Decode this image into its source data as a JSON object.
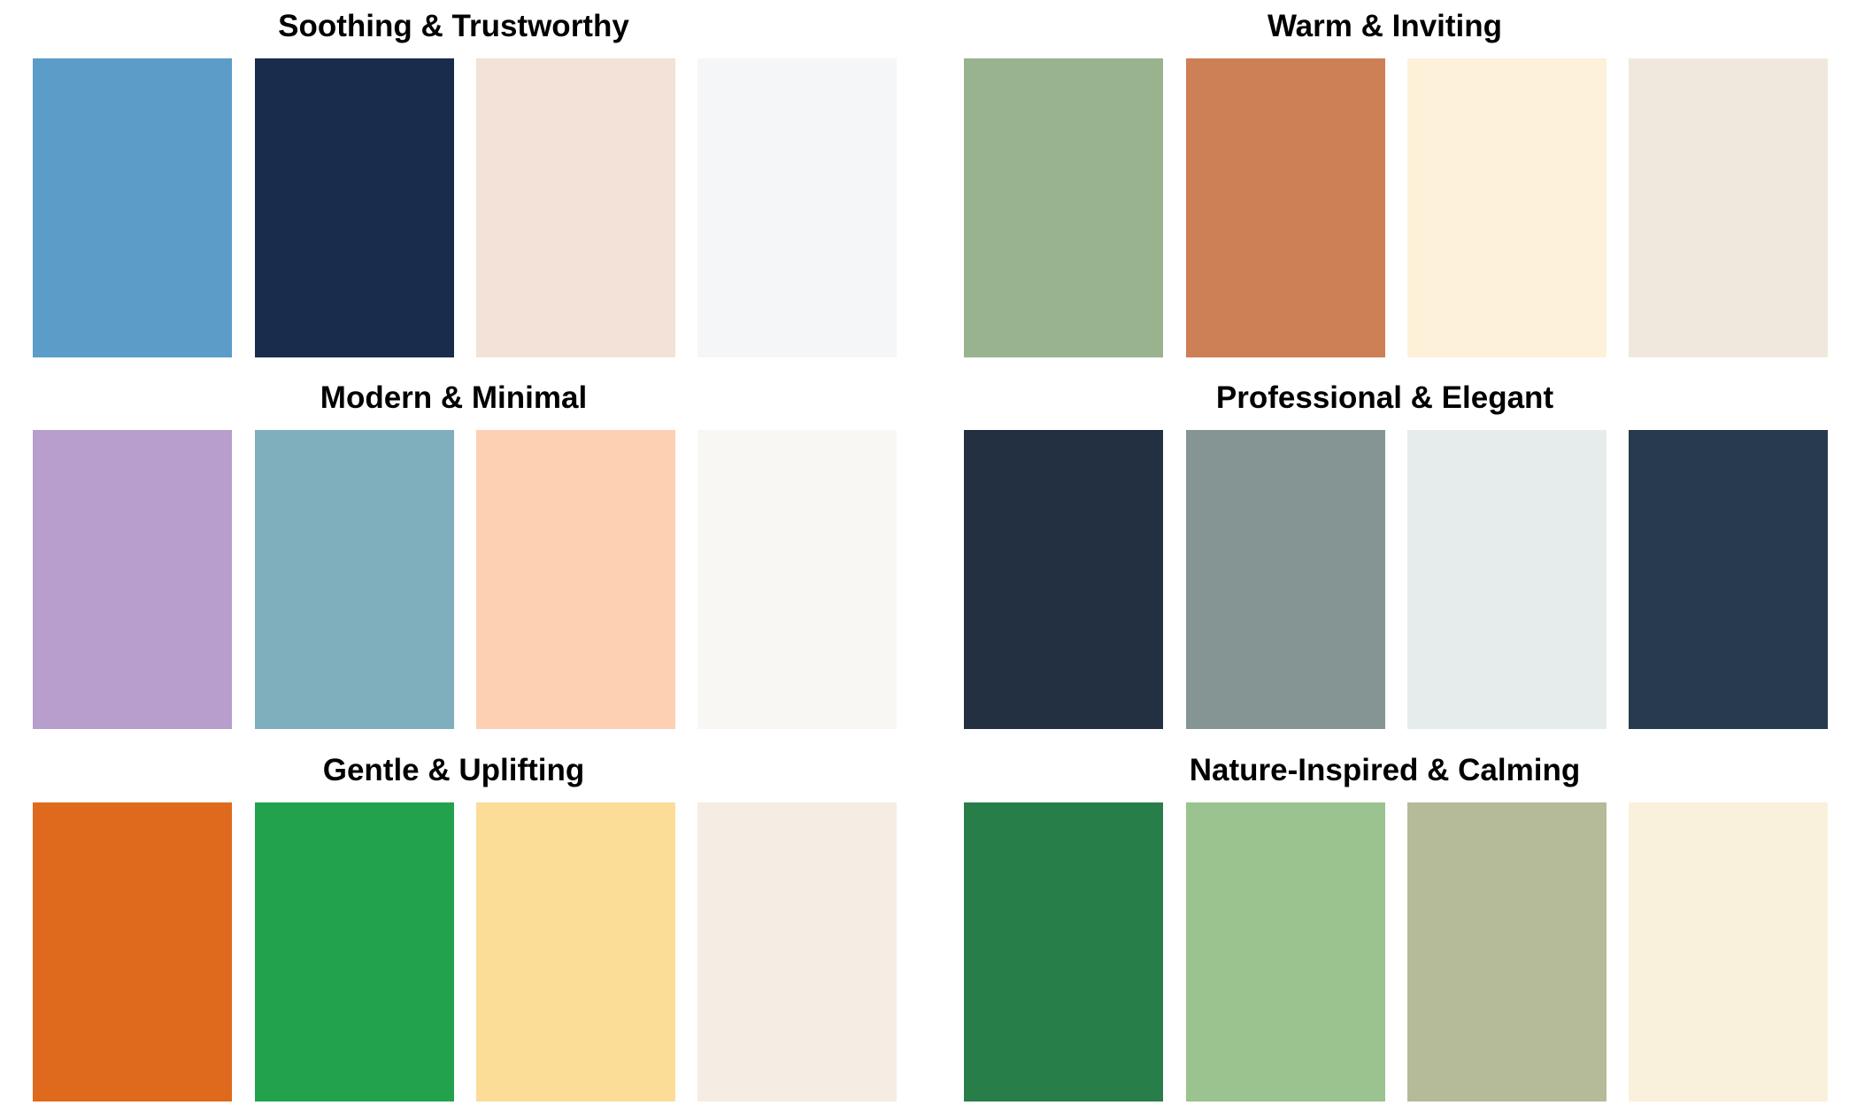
{
  "palettes": [
    {
      "title": "Soothing & Trustworthy",
      "colors": [
        "#5b9cc9",
        "#1a2c4c",
        "#f2e2d7",
        "#f5f6f8"
      ]
    },
    {
      "title": "Warm & Inviting",
      "colors": [
        "#98b38e",
        "#cd7f55",
        "#fef1d9",
        "#f0e8dd"
      ]
    },
    {
      "title": "Modern & Minimal",
      "colors": [
        "#b79ecc",
        "#7faebc",
        "#fdd0b4",
        "#f8f7f3"
      ]
    },
    {
      "title": "Professional & Elegant",
      "colors": [
        "#233041",
        "#849593",
        "#e6ebeb",
        "#273a4e"
      ]
    },
    {
      "title": "Gentle & Uplifting",
      "colors": [
        "#df6a1e",
        "#23a24e",
        "#fbdd97",
        "#f5ece3"
      ]
    },
    {
      "title": "Nature-Inspired & Calming",
      "colors": [
        "#277e48",
        "#9bc38f",
        "#b5ba98",
        "#f9f1dc"
      ]
    }
  ]
}
